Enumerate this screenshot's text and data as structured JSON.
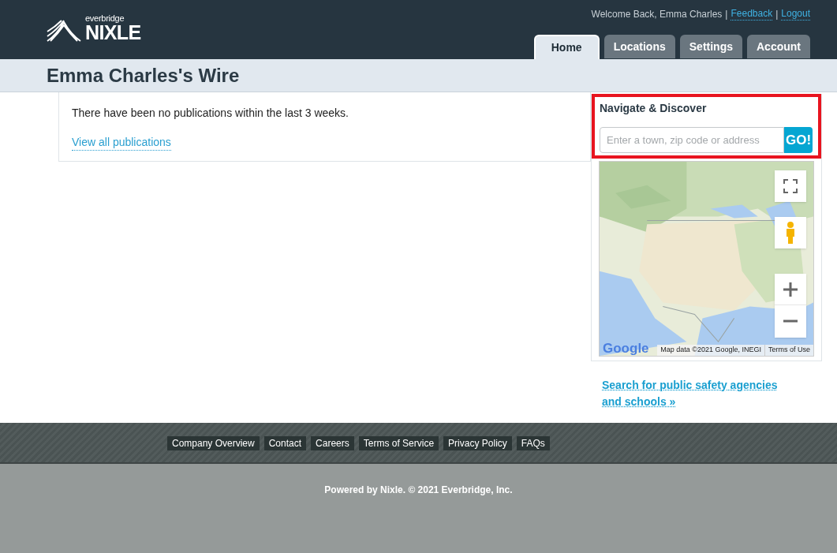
{
  "header": {
    "logo": {
      "small": "everbridge",
      "large": "NIXLE"
    },
    "welcome": "Welcome Back, Emma Charles",
    "links": [
      {
        "separator": "|",
        "label": "Feedback"
      },
      {
        "separator": "|",
        "label": "Logout"
      }
    ],
    "tabs": [
      {
        "label": "Home",
        "selected": true
      },
      {
        "label": "Locations",
        "selected": false
      },
      {
        "label": "Settings",
        "selected": false
      },
      {
        "label": "Account",
        "selected": false
      }
    ]
  },
  "page_title": "Emma Charles's Wire",
  "publications": {
    "message": "There have been no publications within the last 3 weeks.",
    "link": "View all publications"
  },
  "navigate": {
    "title": "Navigate & Discover",
    "search": {
      "placeholder": "Enter a town, zip code or address"
    },
    "go_button": "GO!",
    "highlighted": true,
    "map": {
      "kind": "picture",
      "logo": "Google",
      "attribution": "Map data ©2021 Google, INEGI",
      "terms": "Terms of Use"
    }
  },
  "agency_link": "Search for public safety agencies and schools »",
  "footer": {
    "links": [
      "Company Overview",
      "Contact",
      "Careers",
      "Terms of Service",
      "Privacy Policy",
      "FAQs"
    ],
    "copyright": "Powered by Nixle. © 2021 Everbridge, Inc."
  }
}
